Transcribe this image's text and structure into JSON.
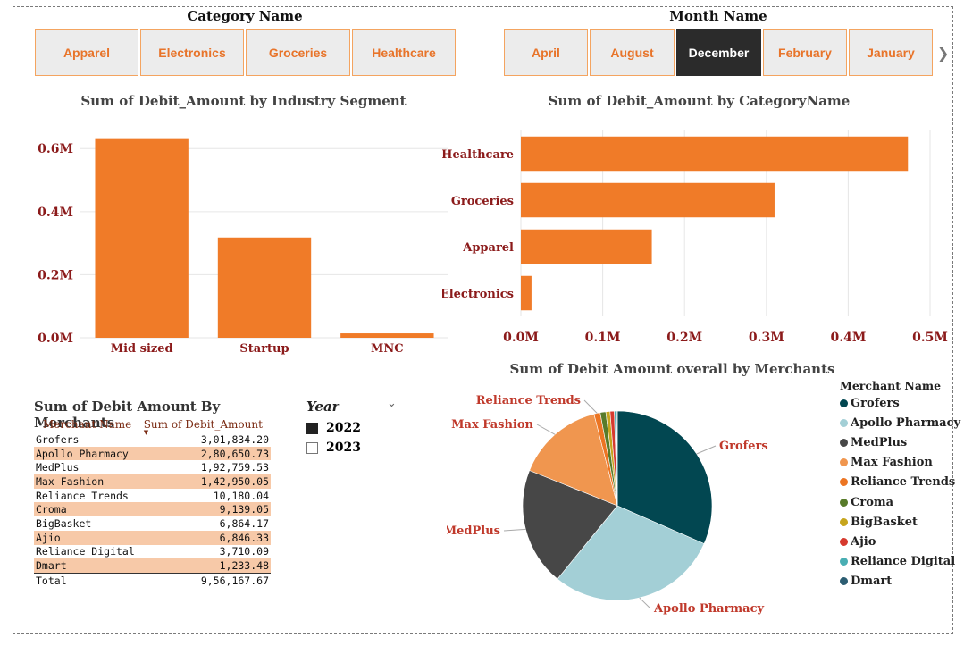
{
  "category_slicer": {
    "title": "Category Name",
    "items": [
      "Apparel",
      "Electronics",
      "Groceries",
      "Healthcare"
    ]
  },
  "month_slicer": {
    "title": "Month Name",
    "items": [
      "April",
      "August",
      "December",
      "February",
      "January"
    ],
    "selected": "December"
  },
  "year_slicer": {
    "title": "Year",
    "options": [
      {
        "label": "2022",
        "checked": true
      },
      {
        "label": "2023",
        "checked": false
      }
    ]
  },
  "table": {
    "title": "Sum of Debit Amount By Merchants",
    "headers": [
      "Merchant Name",
      "Sum of Debit_Amount"
    ],
    "rows": [
      [
        "Grofers",
        "3,01,834.20"
      ],
      [
        "Apollo Pharmacy",
        "2,80,650.73"
      ],
      [
        "MedPlus",
        "1,92,759.53"
      ],
      [
        "Max Fashion",
        "1,42,950.05"
      ],
      [
        "Reliance Trends",
        "10,180.04"
      ],
      [
        "Croma",
        "9,139.05"
      ],
      [
        "BigBasket",
        "6,864.17"
      ],
      [
        "Ajio",
        "6,846.33"
      ],
      [
        "Reliance Digital",
        "3,710.09"
      ],
      [
        "Dmart",
        "1,233.48"
      ]
    ],
    "total": [
      "Total",
      "9,56,167.67"
    ]
  },
  "pie_legend_title": "Merchant Name",
  "colors": {
    "accent": "#f07b28",
    "axis_text": "#8b1a1a",
    "pie": [
      "#024751",
      "#a3cfd6",
      "#474747",
      "#f0964f",
      "#ec7523",
      "#587b2a",
      "#c6a51d",
      "#d63a2e",
      "#49aeb3",
      "#2c5d72"
    ]
  },
  "chart_data": [
    {
      "type": "bar",
      "title": "Sum of Debit_Amount by Industry Segment",
      "categories": [
        "Mid sized",
        "Startup",
        "MNC"
      ],
      "values": [
        630000,
        318000,
        14000
      ],
      "ylim": [
        0,
        680000
      ],
      "yticks": [
        {
          "v": 0,
          "label": "0.0M"
        },
        {
          "v": 200000,
          "label": "0.2M"
        },
        {
          "v": 400000,
          "label": "0.4M"
        },
        {
          "v": 600000,
          "label": "0.6M"
        }
      ],
      "grid": true
    },
    {
      "type": "bar",
      "orientation": "horizontal",
      "title": "Sum of Debit_Amount by CategoryName",
      "categories": [
        "Healthcare",
        "Groceries",
        "Apparel",
        "Electronics"
      ],
      "values": [
        473000,
        310000,
        160000,
        13000
      ],
      "xlim": [
        0,
        500000
      ],
      "xticks": [
        {
          "v": 0,
          "label": "0.0M"
        },
        {
          "v": 100000,
          "label": "0.1M"
        },
        {
          "v": 200000,
          "label": "0.2M"
        },
        {
          "v": 300000,
          "label": "0.3M"
        },
        {
          "v": 400000,
          "label": "0.4M"
        },
        {
          "v": 500000,
          "label": "0.5M"
        }
      ],
      "grid": true
    },
    {
      "type": "pie",
      "title": "Sum of Debit Amount overall by Merchants",
      "labels": [
        "Grofers",
        "Apollo Pharmacy",
        "MedPlus",
        "Max Fashion",
        "Reliance Trends",
        "Croma",
        "BigBasket",
        "Ajio",
        "Reliance Digital",
        "Dmart"
      ],
      "values": [
        301834.2,
        280650.73,
        192759.53,
        142950.05,
        10180.04,
        9139.05,
        6864.17,
        6846.33,
        3710.09,
        1233.48
      ],
      "data_labels": [
        "Reliance Trends",
        "Max Fashion",
        "Grofers",
        "MedPlus",
        "Apollo Pharmacy"
      ],
      "legend": "right"
    }
  ]
}
